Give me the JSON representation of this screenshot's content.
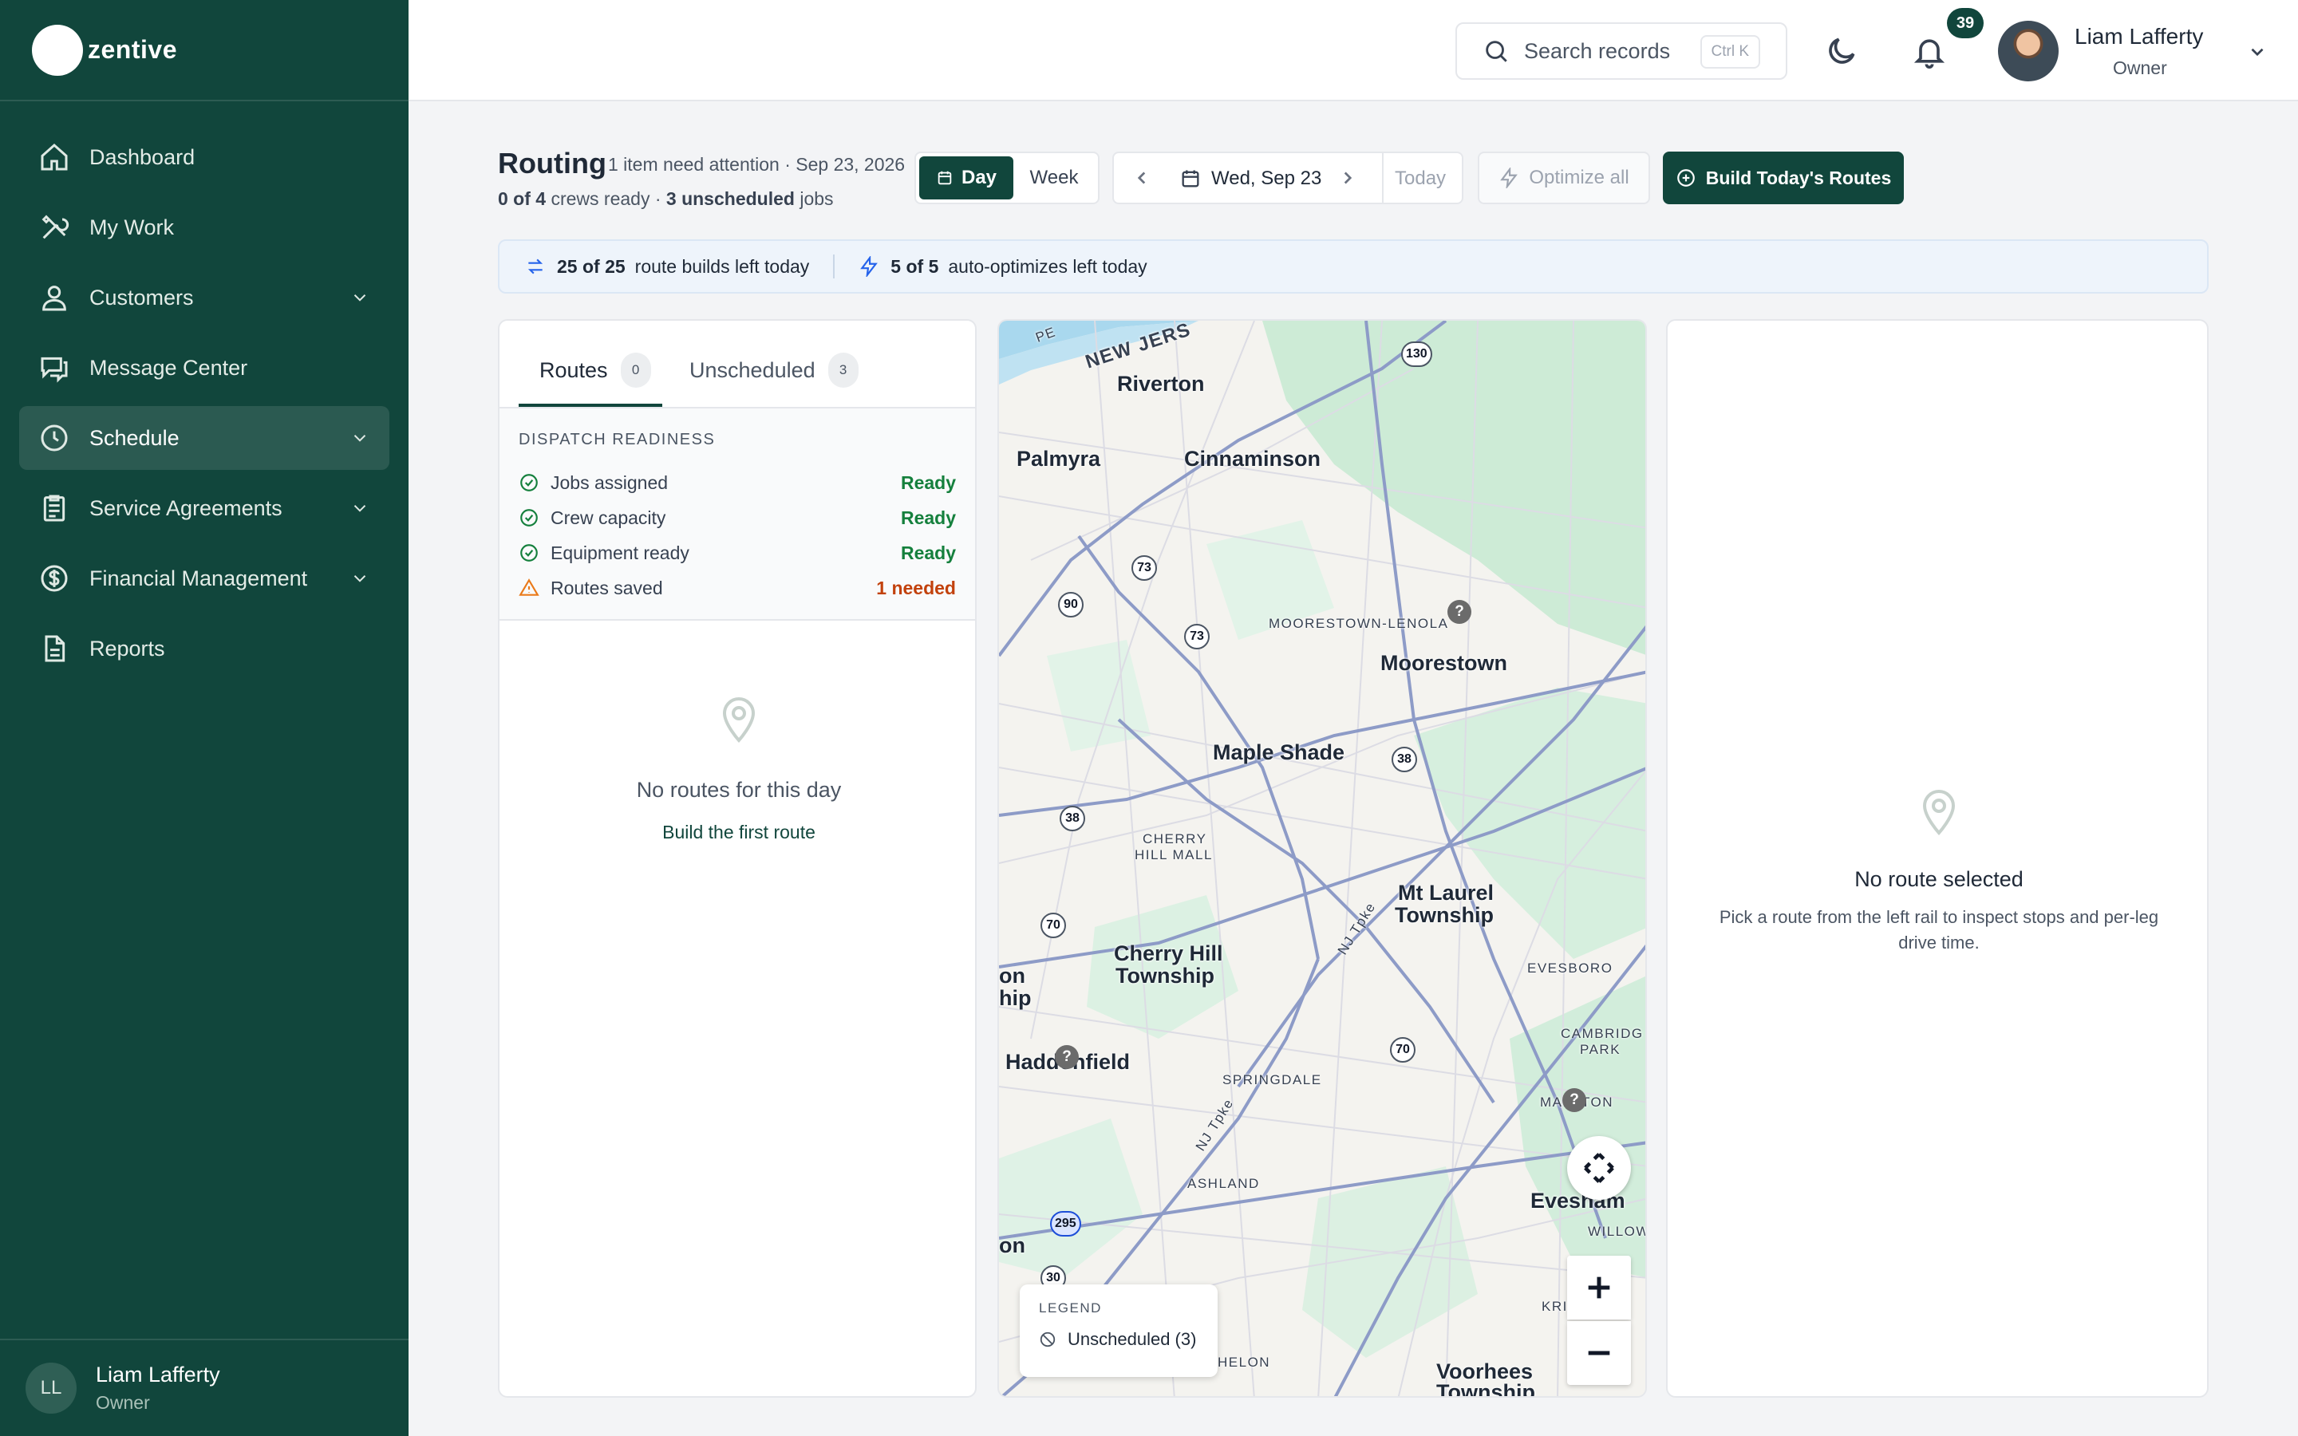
{
  "brand": {
    "name": "zentive"
  },
  "sidebar": {
    "items": [
      {
        "label": "Dashboard",
        "icon": "home-icon"
      },
      {
        "label": "My Work",
        "icon": "tools-icon"
      },
      {
        "label": "Customers",
        "icon": "users-icon"
      },
      {
        "label": "Message Center",
        "icon": "chat-icon"
      },
      {
        "label": "Schedule",
        "icon": "clock-icon",
        "active": true
      },
      {
        "label": "Service Agreements",
        "icon": "clipboard-icon"
      },
      {
        "label": "Financial Management",
        "icon": "dollar-icon"
      },
      {
        "label": "Reports",
        "icon": "report-icon"
      }
    ],
    "user": {
      "initials": "LL",
      "name": "Liam Lafferty",
      "role": "Owner"
    }
  },
  "topbar": {
    "search_placeholder": "Search records",
    "search_shortcut": "Ctrl K",
    "notification_count": "39",
    "user_name": "Liam Lafferty",
    "user_role": "Owner"
  },
  "page": {
    "title": "Routing",
    "attention": "1 item need attention · Sep 23, 2026",
    "crews_ready": "0 of 4",
    "crews_suffix": " crews ready · ",
    "unscheduled": "3 unscheduled",
    "unscheduled_suffix": " jobs",
    "view_day": "Day",
    "view_week": "Week",
    "date_label": "Wed, Sep 23",
    "today_label": "Today",
    "optimize_label": "Optimize all",
    "build_label": "Build Today's Routes"
  },
  "quota": {
    "builds_count": "25 of 25",
    "builds_text": "route builds left today",
    "optimize_count": "5 of 5",
    "optimize_text": "auto-optimizes left today"
  },
  "left_panel": {
    "tabs": [
      {
        "label": "Routes",
        "count": "0"
      },
      {
        "label": "Unscheduled",
        "count": "3"
      }
    ],
    "readiness_title": "DISPATCH READINESS",
    "readiness": [
      {
        "label": "Jobs assigned",
        "status": "Ready",
        "state": "ok"
      },
      {
        "label": "Crew capacity",
        "status": "Ready",
        "state": "ok"
      },
      {
        "label": "Equipment ready",
        "status": "Ready",
        "state": "ok"
      },
      {
        "label": "Routes saved",
        "status": "1 needed",
        "state": "warn"
      }
    ],
    "empty_title": "No routes for this day",
    "empty_link": "Build the first route"
  },
  "colors": {
    "brand": "#11463c",
    "ok": "#15803d",
    "warn": "#c2410c",
    "water": "#a9d8ee",
    "park": "#c8ebd4",
    "road": "#8d9bc7"
  },
  "map": {
    "places": [
      "Riverton",
      "Palmyra",
      "Cinnaminson",
      "Moorestown",
      "Maple Shade",
      "Mt Laurel",
      "Township",
      "Cherry Hill",
      "Township",
      "Haddonfield",
      "Evesham",
      "Voorhees",
      "Township",
      "on",
      "hip",
      "on"
    ],
    "small_places": [
      "NEW JERS",
      "PE",
      "MOORESTOWN-LENOLA",
      "CHERRY",
      "HILL MALL",
      "EVESBORO",
      "CAMBRIDG",
      "PARK",
      "SPRINGDALE",
      "ASHLAND",
      "MARLTON",
      "WILLOW",
      "KRI",
      "HELON"
    ],
    "road_labels": [
      "NJ Tpke",
      "NJ Tpke"
    ],
    "shields": [
      "130",
      "73",
      "90",
      "73",
      "38",
      "38",
      "70",
      "70",
      "295",
      "30"
    ],
    "legend_title": "LEGEND",
    "legend_item": "Unscheduled (3)"
  },
  "right_panel": {
    "title": "No route selected",
    "description": "Pick a route from the left rail to inspect stops and per-leg drive time."
  }
}
